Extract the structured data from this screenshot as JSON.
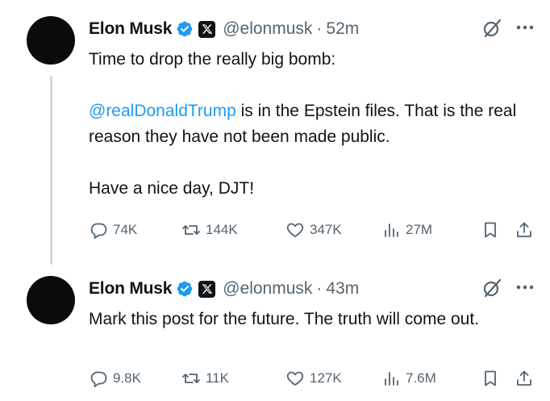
{
  "colors": {
    "text": "#0f1419",
    "muted": "#536471",
    "link": "#1d9bf0",
    "verified": "#1d9bf0",
    "line": "#cfd9de"
  },
  "posts": [
    {
      "author": "Elon Musk",
      "handle": "@elonmusk",
      "separator": "·",
      "time": "52m",
      "body": {
        "line1": "Time to drop the really big bomb:",
        "mention": "@realDonaldTrump",
        "line2_rest": " is in the Epstein files. That is the real reason they have not been made public.",
        "line3": "Have a nice day, DJT!"
      },
      "stats": {
        "replies": "74K",
        "reposts": "144K",
        "likes": "347K",
        "views": "27M"
      }
    },
    {
      "author": "Elon Musk",
      "handle": "@elonmusk",
      "separator": "·",
      "time": "43m",
      "body": {
        "line1": "Mark this post for the future. The truth will come out."
      },
      "stats": {
        "replies": "9.8K",
        "reposts": "11K",
        "likes": "127K",
        "views": "7.6M"
      }
    }
  ],
  "icons": [
    "verified-badge-icon",
    "x-logo-icon",
    "grok-icon",
    "more-icon",
    "reply-icon",
    "repost-icon",
    "like-icon",
    "views-icon",
    "bookmark-icon",
    "share-icon"
  ]
}
